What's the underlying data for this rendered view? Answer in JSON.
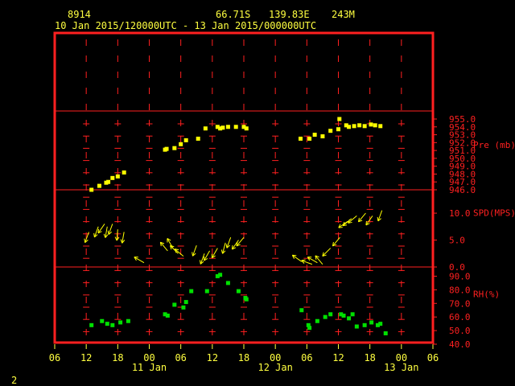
{
  "header": {
    "station_id": "8914",
    "latitude": "66.71S",
    "longitude": "139.83E",
    "elevation": "243M",
    "time_range": "10 Jan 2015/120000UTC - 13 Jan 2015/000000UTC"
  },
  "footer": {
    "page_number": "2"
  },
  "colors": {
    "frame": "#ff2020",
    "text": "#ffff40",
    "pressure": "#ffff00",
    "wind": "#ffff00",
    "rh": "#00e000",
    "grid": "#ff2020"
  },
  "chart_data": [
    {
      "type": "scatter",
      "name_label": "Pre (mb)",
      "ylim": [
        946.0,
        955.0
      ],
      "yticks": [
        "946.0",
        "947.0",
        "948.0",
        "949.0",
        "950.0",
        "951.0",
        "952.0",
        "953.0",
        "954.0",
        "955.0"
      ],
      "points": [
        {
          "x": 13,
          "y": 946.0
        },
        {
          "x": 14.5,
          "y": 946.5
        },
        {
          "x": 15.8,
          "y": 946.9
        },
        {
          "x": 16.2,
          "y": 947.0
        },
        {
          "x": 17,
          "y": 947.5
        },
        {
          "x": 18,
          "y": 947.7
        },
        {
          "x": 19.2,
          "y": 948.2
        },
        {
          "x": 27,
          "y": 951.1
        },
        {
          "x": 27.3,
          "y": 951.2
        },
        {
          "x": 28.8,
          "y": 951.3
        },
        {
          "x": 30,
          "y": 951.8
        },
        {
          "x": 31,
          "y": 952.3
        },
        {
          "x": 33.3,
          "y": 952.5
        },
        {
          "x": 34.7,
          "y": 953.8
        },
        {
          "x": 37,
          "y": 954.0
        },
        {
          "x": 37.5,
          "y": 953.8
        },
        {
          "x": 38,
          "y": 953.9
        },
        {
          "x": 39,
          "y": 954.0
        },
        {
          "x": 40.5,
          "y": 954.0
        },
        {
          "x": 42,
          "y": 954.0
        },
        {
          "x": 42.5,
          "y": 953.8
        },
        {
          "x": 52.8,
          "y": 952.5
        },
        {
          "x": 54.5,
          "y": 952.5
        },
        {
          "x": 55.5,
          "y": 953.0
        },
        {
          "x": 57,
          "y": 952.8
        },
        {
          "x": 58.5,
          "y": 953.5
        },
        {
          "x": 60,
          "y": 953.7
        },
        {
          "x": 60.2,
          "y": 955.0
        },
        {
          "x": 61.5,
          "y": 954.2
        },
        {
          "x": 62,
          "y": 954.0
        },
        {
          "x": 63,
          "y": 954.1
        },
        {
          "x": 64,
          "y": 954.2
        },
        {
          "x": 65,
          "y": 954.1
        },
        {
          "x": 66.2,
          "y": 954.3
        },
        {
          "x": 67,
          "y": 954.2
        },
        {
          "x": 68,
          "y": 954.1
        }
      ]
    },
    {
      "type": "scatter",
      "subtype": "wind_arrows",
      "name_label": "SPD(MPS)",
      "ylim": [
        0,
        13
      ],
      "yticks": [
        "0.0",
        "5.0",
        "10.0"
      ],
      "points": [
        {
          "x": 12.5,
          "y": 6.5,
          "dir": 200
        },
        {
          "x": 14.3,
          "y": 7.5,
          "dir": 200
        },
        {
          "x": 15.5,
          "y": 8,
          "dir": 215
        },
        {
          "x": 16,
          "y": 7.5,
          "dir": 190
        },
        {
          "x": 17,
          "y": 8,
          "dir": 200
        },
        {
          "x": 18,
          "y": 7,
          "dir": 185
        },
        {
          "x": 19.2,
          "y": 6.5,
          "dir": 190
        },
        {
          "x": 23,
          "y": 0.8,
          "dir": 300
        },
        {
          "x": 27.5,
          "y": 3,
          "dir": 320
        },
        {
          "x": 28.5,
          "y": 3.5,
          "dir": 330
        },
        {
          "x": 29.5,
          "y": 2.5,
          "dir": 315
        },
        {
          "x": 30.5,
          "y": 2.0,
          "dir": 310
        },
        {
          "x": 33,
          "y": 4,
          "dir": 200
        },
        {
          "x": 34.5,
          "y": 2.5,
          "dir": 200
        },
        {
          "x": 35.5,
          "y": 3,
          "dir": 210
        },
        {
          "x": 37,
          "y": 3.5,
          "dir": 210
        },
        {
          "x": 38.5,
          "y": 4.5,
          "dir": 195
        },
        {
          "x": 39.5,
          "y": 5.5,
          "dir": 200
        },
        {
          "x": 41,
          "y": 5,
          "dir": 215
        },
        {
          "x": 42,
          "y": 5.5,
          "dir": 220
        },
        {
          "x": 53,
          "y": 1.0,
          "dir": 305
        },
        {
          "x": 55,
          "y": 0.5,
          "dir": 290
        },
        {
          "x": 56,
          "y": 0.8,
          "dir": 300
        },
        {
          "x": 57,
          "y": 0.5,
          "dir": 320
        },
        {
          "x": 58.5,
          "y": 3.5,
          "dir": 225
        },
        {
          "x": 60.3,
          "y": 5.5,
          "dir": 220
        },
        {
          "x": 61.8,
          "y": 8.5,
          "dir": 235
        },
        {
          "x": 62.5,
          "y": 9,
          "dir": 230
        },
        {
          "x": 63.5,
          "y": 9.5,
          "dir": 230
        },
        {
          "x": 65.2,
          "y": 10,
          "dir": 220
        },
        {
          "x": 66.5,
          "y": 9.5,
          "dir": 215
        },
        {
          "x": 68.3,
          "y": 10.5,
          "dir": 200
        }
      ]
    },
    {
      "type": "scatter",
      "name_label": "RH(%)",
      "ylim": [
        40.0,
        95.0
      ],
      "yticks": [
        "40.0",
        "50.0",
        "60.0",
        "70.0",
        "80.0",
        "90.0"
      ],
      "points": [
        {
          "x": 13,
          "y": 54
        },
        {
          "x": 15,
          "y": 57
        },
        {
          "x": 16,
          "y": 55
        },
        {
          "x": 17,
          "y": 54
        },
        {
          "x": 18.5,
          "y": 56
        },
        {
          "x": 20,
          "y": 57
        },
        {
          "x": 27,
          "y": 62
        },
        {
          "x": 27.5,
          "y": 61
        },
        {
          "x": 28.8,
          "y": 69
        },
        {
          "x": 30.5,
          "y": 67
        },
        {
          "x": 31,
          "y": 71
        },
        {
          "x": 32,
          "y": 79
        },
        {
          "x": 35,
          "y": 79
        },
        {
          "x": 37,
          "y": 90
        },
        {
          "x": 37.5,
          "y": 91
        },
        {
          "x": 39,
          "y": 85
        },
        {
          "x": 41,
          "y": 79
        },
        {
          "x": 42.3,
          "y": 74
        },
        {
          "x": 42.5,
          "y": 73
        },
        {
          "x": 53,
          "y": 65
        },
        {
          "x": 54.3,
          "y": 54
        },
        {
          "x": 54.5,
          "y": 52
        },
        {
          "x": 56,
          "y": 57
        },
        {
          "x": 57.5,
          "y": 60
        },
        {
          "x": 58.5,
          "y": 62
        },
        {
          "x": 60.5,
          "y": 62
        },
        {
          "x": 61,
          "y": 61
        },
        {
          "x": 62,
          "y": 59
        },
        {
          "x": 62.7,
          "y": 62
        },
        {
          "x": 63.5,
          "y": 53
        },
        {
          "x": 65,
          "y": 54
        },
        {
          "x": 66.3,
          "y": 56
        },
        {
          "x": 67.5,
          "y": 54
        },
        {
          "x": 68,
          "y": 55
        },
        {
          "x": 69,
          "y": 48
        }
      ]
    }
  ],
  "x_axis": {
    "xlim": [
      6,
      78
    ],
    "ticks": [
      {
        "x": 6,
        "label": "06"
      },
      {
        "x": 12,
        "label": "12"
      },
      {
        "x": 18,
        "label": "18"
      },
      {
        "x": 24,
        "label": "00"
      },
      {
        "x": 30,
        "label": "06"
      },
      {
        "x": 36,
        "label": "12"
      },
      {
        "x": 42,
        "label": "18"
      },
      {
        "x": 48,
        "label": "00"
      },
      {
        "x": 54,
        "label": "06"
      },
      {
        "x": 60,
        "label": "12"
      },
      {
        "x": 66,
        "label": "18"
      },
      {
        "x": 72,
        "label": "00"
      },
      {
        "x": 78,
        "label": "06"
      }
    ],
    "day_labels": [
      {
        "x": 24,
        "label": "11 Jan"
      },
      {
        "x": 48,
        "label": "12 Jan"
      },
      {
        "x": 72,
        "label": "13 Jan"
      }
    ]
  }
}
